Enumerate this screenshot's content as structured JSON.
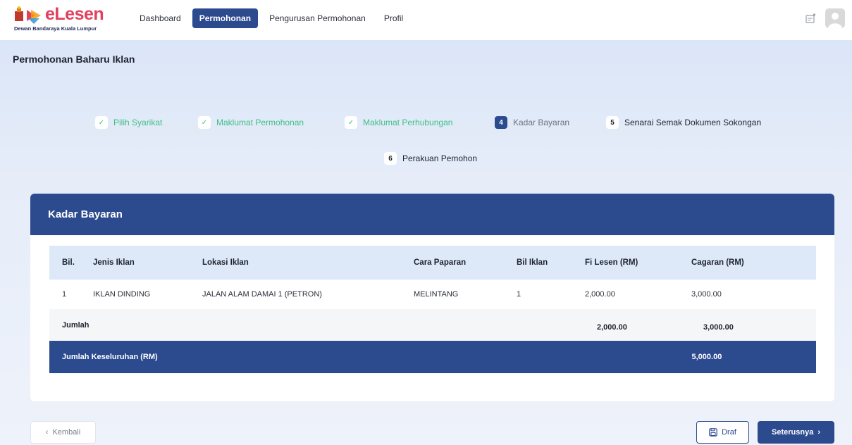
{
  "brand": {
    "name": "eLesen",
    "subtitle": "Dewan Bandaraya Kuala Lumpur",
    "accent_color": "#e2405f",
    "primary_color": "#2c4a8e"
  },
  "nav": {
    "items": [
      {
        "label": "Dashboard",
        "active": false
      },
      {
        "label": "Permohonan",
        "active": true
      },
      {
        "label": "Pengurusan Permohonan",
        "active": false
      },
      {
        "label": "Profil",
        "active": false
      }
    ]
  },
  "header_icons": {
    "notification": "notification-icon",
    "avatar": "user-avatar-icon"
  },
  "page": {
    "title": "Permohonan Baharu Iklan"
  },
  "stepper": {
    "steps": [
      {
        "badge": "✓",
        "label": "Pilih Syarikat",
        "status": "done"
      },
      {
        "badge": "✓",
        "label": "Maklumat Permohonan",
        "status": "done"
      },
      {
        "badge": "✓",
        "label": "Maklumat Perhubungan",
        "status": "done"
      },
      {
        "badge": "4",
        "label": "Kadar Bayaran",
        "status": "current"
      },
      {
        "badge": "5",
        "label": "Senarai Semak Dokumen Sokongan",
        "status": "todo"
      },
      {
        "badge": "6",
        "label": "Perakuan Pemohon",
        "status": "todo"
      }
    ]
  },
  "card": {
    "title": "Kadar Bayaran"
  },
  "table": {
    "headers": [
      "Bil.",
      "Jenis Iklan",
      "Lokasi Iklan",
      "Cara Paparan",
      "Bil Iklan",
      "Fi Lesen (RM)",
      "Cagaran (RM)"
    ],
    "rows": [
      [
        "1",
        "IKLAN DINDING",
        "JALAN ALAM DAMAI 1 (PETRON)",
        "MELINTANG",
        "1",
        "2,000.00",
        "3,000.00"
      ]
    ],
    "sum": {
      "label": "Jumlah",
      "fi": "2,000.00",
      "cagaran": "3,000.00"
    },
    "total": {
      "label": "Jumlah Keseluruhan (RM)",
      "value": "5,000.00"
    }
  },
  "footer": {
    "back_label": "Kembali",
    "draft_label": "Draf",
    "next_label": "Seterusnya"
  }
}
